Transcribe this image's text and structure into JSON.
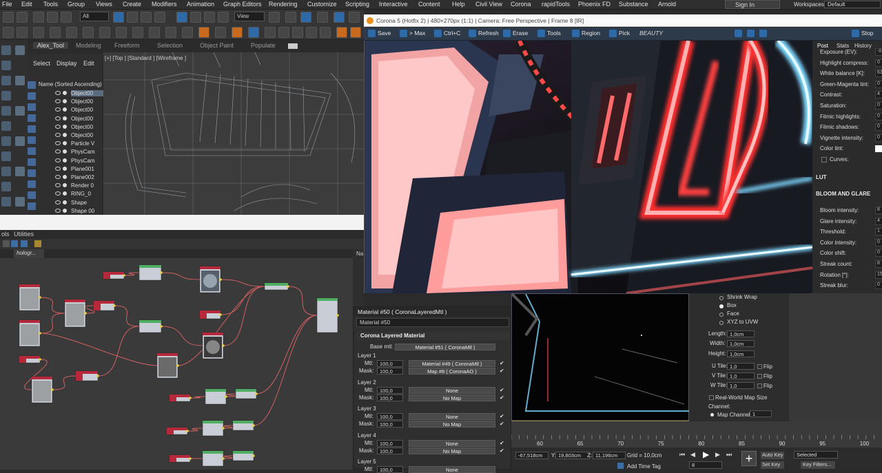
{
  "menu": {
    "items": [
      "File",
      "Edit",
      "Tools",
      "Group",
      "Views",
      "Create",
      "Modifiers",
      "Animation",
      "Graph Editors",
      "Rendering",
      "Customize",
      "Scripting",
      "Interactive",
      "Content",
      "Help",
      "Civil View",
      "Corona",
      "rapidTools",
      "Phoenix FD",
      "Substance",
      "Arnold"
    ],
    "sign_in": "Sign In",
    "workspaces_label": "Workspaces:",
    "workspace_value": "Default"
  },
  "toolbar": {
    "filter_select": "All",
    "view_select": "View"
  },
  "scene_explorer": {
    "tabs": [
      "Alex_Tool",
      "Modeling",
      "Freeform",
      "Selection",
      "Object Paint",
      "Populate"
    ],
    "menu": [
      "Select",
      "Display",
      "Edit"
    ],
    "column_header": "Name (Sorted Ascending)",
    "objects": [
      "Object00",
      "Object00",
      "Object00",
      "Object00",
      "Object00",
      "Object00",
      "Particle V",
      "PhysCam",
      "PhysCam",
      "Plane001",
      "Plane002",
      "Render 0",
      "RING_0",
      "Shape",
      "Shape 00"
    ]
  },
  "viewport": {
    "label": "[+] [Top ] [Standard ] [Wireframe ]"
  },
  "command_panel": {
    "left_tab": "ols",
    "utilities_tab": "Utilities"
  },
  "slate": {
    "tab": "hologr...",
    "right_label": "Na"
  },
  "vfb": {
    "title": "Corona 5 (Hotfix 2) | 480×270px (1:1) | Camera: Free Perspective | Frame 8 [IR]",
    "buttons": [
      "Save",
      "> Max",
      "Ctrl+C",
      "Refresh",
      "Erase",
      "Tools",
      "Region",
      "Pick"
    ],
    "channel": "BEAUTY",
    "stop": "Stop"
  },
  "post_panel": {
    "tabs": [
      "Post",
      "Stats",
      "History"
    ],
    "rows": [
      {
        "label": "Exposure (EV):",
        "value": "-0"
      },
      {
        "label": "Highlight compress:",
        "value": "0"
      },
      {
        "label": "White balance [K]:",
        "value": "63"
      },
      {
        "label": "Green-Magenta tint:",
        "value": "0"
      },
      {
        "label": "Contrast:",
        "value": "4"
      },
      {
        "label": "Saturation:",
        "value": "0"
      },
      {
        "label": "Filmic highlights:",
        "value": "0"
      },
      {
        "label": "Filmic shadows:",
        "value": "0"
      },
      {
        "label": "Vignette intensity:",
        "value": "0"
      }
    ],
    "color_tint": "Color tint:",
    "curves": "Curves:",
    "lut": "LUT",
    "bloom_section": "BLOOM AND GLARE",
    "bloom_rows": [
      {
        "label": "Bloom intensity:",
        "value": "8"
      },
      {
        "label": "Glare intensity:",
        "value": "4"
      },
      {
        "label": "Threshold:",
        "value": "1"
      },
      {
        "label": "Color intensity:",
        "value": "0"
      },
      {
        "label": "Color shift:",
        "value": "0"
      },
      {
        "label": "Streak count:",
        "value": "8"
      },
      {
        "label": "Rotation [°]:",
        "value": "15"
      },
      {
        "label": "Streak blur:",
        "value": "0"
      }
    ]
  },
  "material": {
    "title": "Material #50  ( CoronaLayeredMtl )",
    "name": "Material #50",
    "rollout": "Corona Layered Material",
    "base_label": "Base mtl:",
    "base_value": "Material #51  ( CoronaMtl )",
    "layers": [
      {
        "title": "Layer 1",
        "mtl_amount": "100,0",
        "mtl": "Material #49  ( CoronaMtl )",
        "mask_amount": "100,0",
        "mask": "Map #8  ( CoronaAO )"
      },
      {
        "title": "Layer 2",
        "mtl_amount": "100,0",
        "mtl": "None",
        "mask_amount": "100,0",
        "mask": "No Map"
      },
      {
        "title": "Layer 3",
        "mtl_amount": "100,0",
        "mtl": "None",
        "mask_amount": "100,0",
        "mask": "No Map"
      },
      {
        "title": "Layer 4",
        "mtl_amount": "100,0",
        "mtl": "None",
        "mask_amount": "100,0",
        "mask": "No Map"
      },
      {
        "title": "Layer 5",
        "mtl_amount": "100,0",
        "mtl": "None",
        "mask_amount": "",
        "mask": ""
      }
    ],
    "mtl_label": "Mtl:",
    "mask_label": "Mask:"
  },
  "uvw": {
    "options": [
      "Shrink Wrap",
      "Box",
      "Face",
      "XYZ to UVW"
    ],
    "selected_option": "Box",
    "length_label": "Length:",
    "length": "1,0cm",
    "width_label": "Width:",
    "width": "1,0cm",
    "height_label": "Height:",
    "height": "1,0cm",
    "utile_label": "U Tile:",
    "utile": "1,0",
    "vtile_label": "V Tile:",
    "vtile": "1,0",
    "wtile_label": "W Tile:",
    "wtile": "1,0",
    "flip": "Flip",
    "realworld": "Real-World Map Size",
    "channel_label": "Channel:",
    "map_channel_label": "Map Channel:",
    "map_channel": "1"
  },
  "timeline": {
    "ticks": [
      "60",
      "65",
      "70",
      "75",
      "80",
      "85",
      "90",
      "95",
      "100"
    ]
  },
  "status": {
    "x": "-67,518cm",
    "y_label": "Y:",
    "y": "19,803cm",
    "z_label": "Z:",
    "z": "11,196cm",
    "grid": "Grid = 10,0cm",
    "add_time_tag": "Add Time Tag",
    "frame": "8",
    "auto_key": "Auto Key",
    "set_key": "Set Key",
    "selected": "Selected",
    "key_filters": "Key Filters..."
  }
}
